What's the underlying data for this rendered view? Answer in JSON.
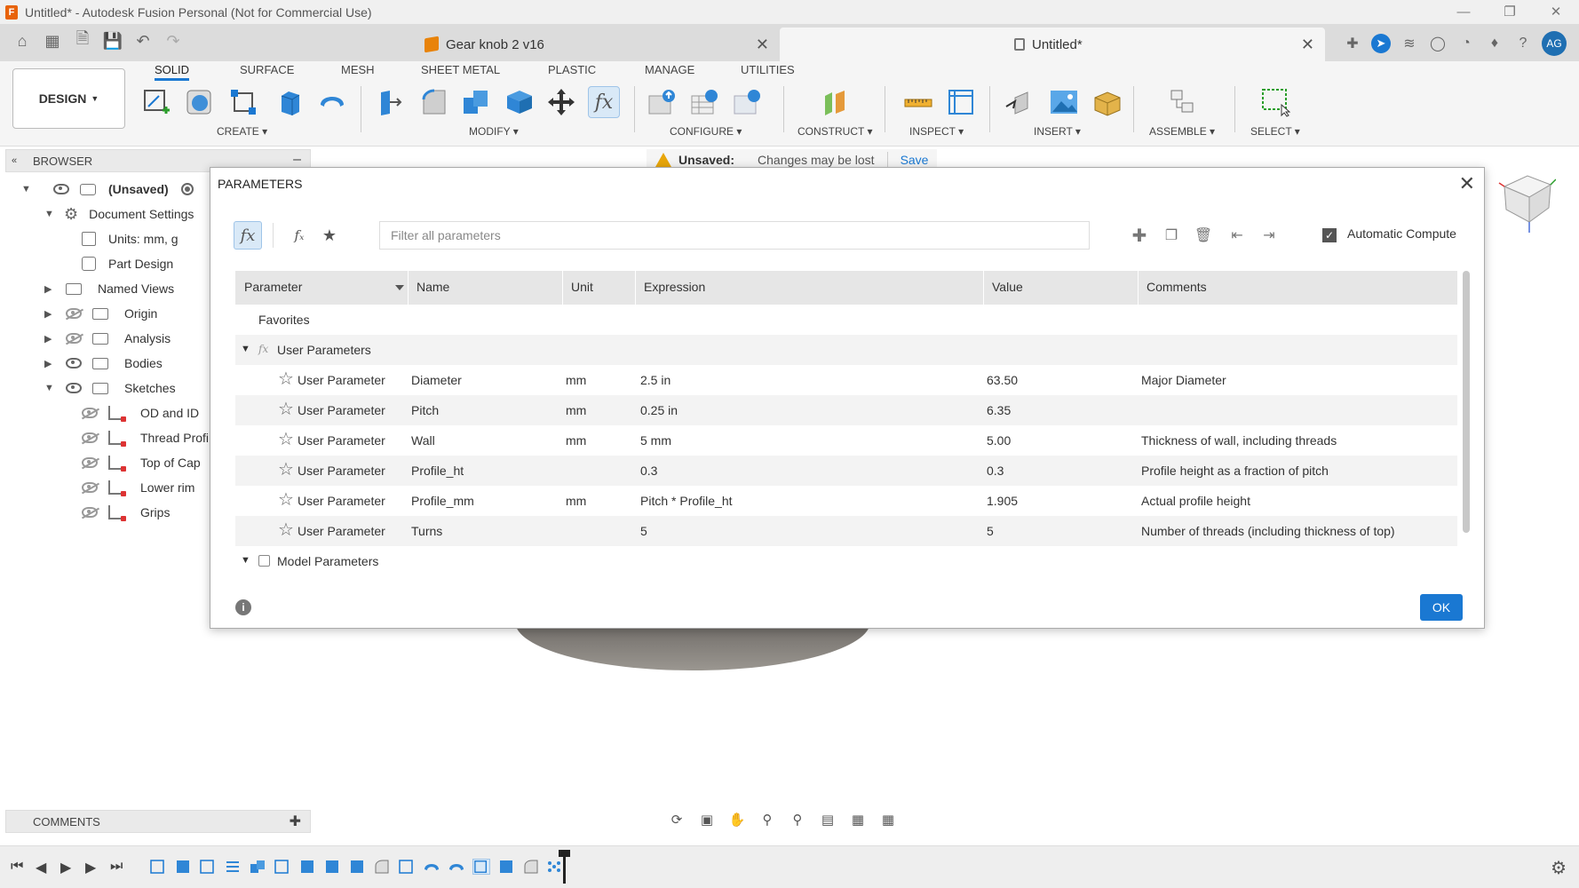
{
  "window": {
    "title": "Untitled* - Autodesk Fusion Personal (Not for Commercial Use)"
  },
  "tabs": [
    {
      "label": "Gear knob 2 v16"
    },
    {
      "label": "Untitled*"
    }
  ],
  "user_initials": "AG",
  "ribbon": {
    "workspace": "DESIGN",
    "tabs": [
      "SOLID",
      "SURFACE",
      "MESH",
      "SHEET METAL",
      "PLASTIC",
      "MANAGE",
      "UTILITIES"
    ],
    "active_tab": "SOLID",
    "groups": [
      "CREATE",
      "MODIFY",
      "CONFIGURE",
      "CONSTRUCT",
      "INSPECT",
      "INSERT",
      "ASSEMBLE",
      "SELECT"
    ]
  },
  "browser": {
    "title": "BROWSER",
    "root": "(Unsaved)",
    "items": [
      {
        "label": "Document Settings"
      },
      {
        "label": "Units: mm, g"
      },
      {
        "label": "Part Design"
      },
      {
        "label": "Named Views"
      },
      {
        "label": "Origin"
      },
      {
        "label": "Analysis"
      },
      {
        "label": "Bodies"
      },
      {
        "label": "Sketches"
      },
      {
        "label": "OD and ID"
      },
      {
        "label": "Thread Profi"
      },
      {
        "label": "Top of Cap"
      },
      {
        "label": "Lower rim"
      },
      {
        "label": "Grips"
      }
    ]
  },
  "banner": {
    "status": "Unsaved:",
    "message": "Changes may be lost",
    "action": "Save"
  },
  "dialog": {
    "title": "PARAMETERS",
    "filter_placeholder": "Filter all parameters",
    "auto_compute_label": "Automatic Compute",
    "auto_compute_checked": true,
    "columns": [
      "Parameter",
      "Name",
      "Unit",
      "Expression",
      "Value",
      "Comments"
    ],
    "sections": {
      "favorites": "Favorites",
      "user": "User Parameters",
      "model": "Model Parameters"
    },
    "rows": [
      {
        "parameter": "User Parameter",
        "name": "Diameter",
        "unit": "mm",
        "expression": "2.5 in",
        "value": "63.50",
        "comment": "Major Diameter"
      },
      {
        "parameter": "User Parameter",
        "name": "Pitch",
        "unit": "mm",
        "expression": "0.25 in",
        "value": "6.35",
        "comment": ""
      },
      {
        "parameter": "User Parameter",
        "name": "Wall",
        "unit": "mm",
        "expression": "5 mm",
        "value": "5.00",
        "comment": "Thickness of wall, including threads"
      },
      {
        "parameter": "User Parameter",
        "name": "Profile_ht",
        "unit": "",
        "expression": "0.3",
        "value": "0.3",
        "comment": "Profile height as a fraction of pitch"
      },
      {
        "parameter": "User Parameter",
        "name": "Profile_mm",
        "unit": "mm",
        "expression": "Pitch * Profile_ht",
        "value": "1.905",
        "comment": "Actual profile height"
      },
      {
        "parameter": "User Parameter",
        "name": "Turns",
        "unit": "",
        "expression": "5",
        "value": "5",
        "comment": "Number of threads (including thickness of top)"
      }
    ],
    "ok_label": "OK"
  },
  "comments_panel": {
    "title": "COMMENTS"
  },
  "colors": {
    "accent": "#1a78d2",
    "warning": "#e8a60a"
  }
}
